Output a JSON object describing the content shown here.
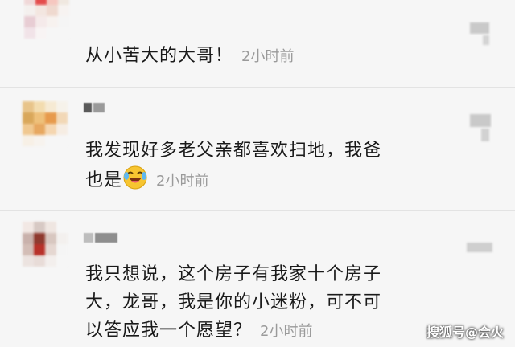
{
  "comments": [
    {
      "text": "从小苦大的大哥！",
      "time": "2小时前"
    },
    {
      "text_line1": "我发现好多老父亲都喜欢扫地，我爸",
      "text_line2": "也是",
      "emoji": "laughing-tears-emoji",
      "time": "2小时前"
    },
    {
      "text_line1": "我只想说，这个房子有我家十个房子",
      "text_line2": "大，龙哥，我是你的小迷粉，可不可",
      "text_line3": "以答应我一个愿望？",
      "time": "2小时前"
    }
  ],
  "watermark": "搜狐号@会火",
  "colors": {
    "background": "#f6f6f6",
    "text": "#1a1a1a",
    "time": "#9a9a9a"
  }
}
